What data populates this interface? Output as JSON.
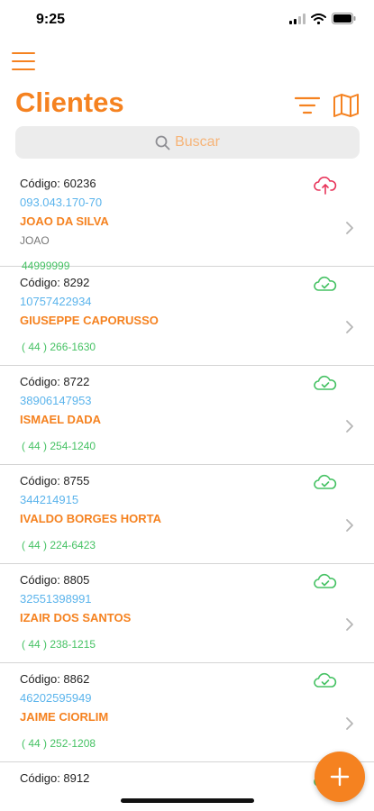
{
  "status": {
    "time": "9:25"
  },
  "header": {
    "title": "Clientes"
  },
  "search": {
    "placeholder": "Buscar"
  },
  "colors": {
    "accent": "#f58220",
    "doc": "#5bb4ec",
    "phone": "#46c264",
    "sync_pending": "#e8345a",
    "sync_done": "#46c264"
  },
  "clients": [
    {
      "code": "Código: 60236",
      "doc": "093.043.170-70",
      "name": "JOAO DA SILVA",
      "alias": "JOAO",
      "phone": "44999999",
      "sync": "cloud-upload-icon"
    },
    {
      "code": "Código: 8292",
      "doc": "10757422934",
      "name": "GIUSEPPE CAPORUSSO",
      "phone": "( 44 ) 266-1630",
      "sync": "cloud-check-icon"
    },
    {
      "code": "Código: 8722",
      "doc": "38906147953",
      "name": "ISMAEL DADA",
      "phone": "( 44 ) 254-1240",
      "sync": "cloud-check-icon"
    },
    {
      "code": "Código: 8755",
      "doc": "344214915",
      "name": "IVALDO BORGES HORTA",
      "phone": "( 44 ) 224-6423",
      "sync": "cloud-check-icon"
    },
    {
      "code": "Código: 8805",
      "doc": "32551398991",
      "name": "IZAIR DOS SANTOS",
      "phone": "( 44 ) 238-1215",
      "sync": "cloud-check-icon"
    },
    {
      "code": "Código: 8862",
      "doc": "46202595949",
      "name": "JAIME CIORLIM",
      "phone": "( 44 ) 252-1208",
      "sync": "cloud-check-icon"
    },
    {
      "code": "Código: 8912",
      "sync": "cloud-check-icon"
    }
  ]
}
